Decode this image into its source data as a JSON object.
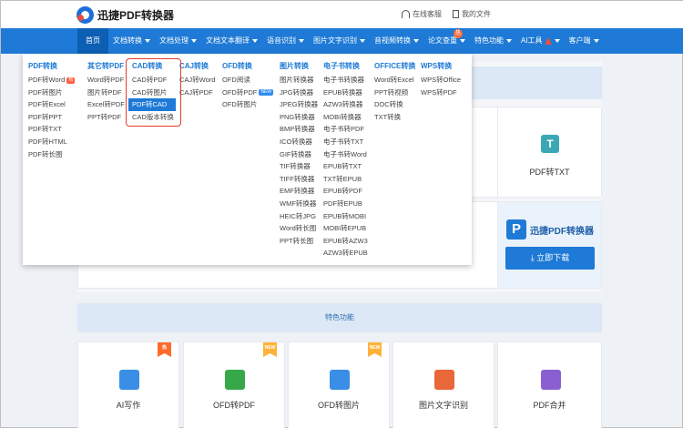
{
  "header": {
    "logo_text": "迅捷PDF转换器",
    "links": [
      {
        "label": "在线客服",
        "icon": "headset-icon"
      },
      {
        "label": "我的文件",
        "icon": "file-icon"
      }
    ]
  },
  "nav": {
    "items": [
      {
        "label": "首页",
        "active": true
      },
      {
        "label": "文档转换",
        "caret": true
      },
      {
        "label": "文档处理",
        "caret": true
      },
      {
        "label": "文档文本翻译",
        "caret": true
      },
      {
        "label": "语音识别",
        "caret": true
      },
      {
        "label": "图片文字识别",
        "caret": true
      },
      {
        "label": "音视频转换",
        "caret": true
      },
      {
        "label": "论文查重",
        "caret": true,
        "badge": "热"
      },
      {
        "label": "特色功能",
        "caret": true
      },
      {
        "label": "AI工具",
        "caret": true,
        "flame": true
      },
      {
        "label": "客户端",
        "caret": true
      }
    ]
  },
  "dropdown": {
    "columns": [
      {
        "title": "PDF转换",
        "items": [
          {
            "label": "PDF转Word",
            "tag": "hot"
          },
          {
            "label": "PDF转图片"
          },
          {
            "label": "PDF转Excel"
          },
          {
            "label": "PDF转PPT"
          },
          {
            "label": "PDF转TXT"
          },
          {
            "label": "PDF转HTML"
          },
          {
            "label": "PDF转长图"
          }
        ]
      },
      {
        "title": "其它转PDF",
        "items": [
          {
            "label": "Word转PDF"
          },
          {
            "label": "图片转PDF"
          },
          {
            "label": "Excel转PDF"
          },
          {
            "label": "PPT转PDF"
          }
        ]
      },
      {
        "title": "CAD转换",
        "items": [
          {
            "label": "CAD转PDF"
          },
          {
            "label": "CAD转图片"
          },
          {
            "label": "PDF转CAD",
            "selected": true
          },
          {
            "label": "CAD版本转换"
          }
        ]
      },
      {
        "title": "CAJ转换",
        "items": [
          {
            "label": "CAJ转Word"
          },
          {
            "label": "CAJ转PDF"
          }
        ]
      },
      {
        "title": "OFD转换",
        "items": [
          {
            "label": "OFD阅读"
          },
          {
            "label": "OFD转PDF",
            "tag": "new"
          },
          {
            "label": "OFD转图片"
          }
        ]
      },
      {
        "title": "图片转换",
        "items": [
          {
            "label": "图片转换器"
          },
          {
            "label": "JPG转换器"
          },
          {
            "label": "JPEG转换器"
          },
          {
            "label": "PNG转换器"
          },
          {
            "label": "BMP转换器"
          },
          {
            "label": "ICO转换器"
          },
          {
            "label": "GIF转换器"
          },
          {
            "label": "TIF转换器"
          },
          {
            "label": "TIFF转换器"
          },
          {
            "label": "EMF转换器"
          },
          {
            "label": "WMF转换器"
          },
          {
            "label": "HEIC转JPG"
          },
          {
            "label": "Word转长图"
          },
          {
            "label": "PPT转长图"
          }
        ]
      },
      {
        "title": "电子书转换",
        "items": [
          {
            "label": "电子书转换器"
          },
          {
            "label": "EPUB转换器"
          },
          {
            "label": "AZW3转换器"
          },
          {
            "label": "MOBI转换器"
          },
          {
            "label": "电子书转PDF"
          },
          {
            "label": "电子书转TXT"
          },
          {
            "label": "电子书转Word"
          },
          {
            "label": "EPUB转TXT"
          },
          {
            "label": "TXT转EPUB"
          },
          {
            "label": "EPUB转PDF"
          },
          {
            "label": "PDF转EPUB"
          },
          {
            "label": "EPUB转MOBI"
          },
          {
            "label": "MOBI转EPUB"
          },
          {
            "label": "EPUB转AZW3"
          },
          {
            "label": "AZW3转EPUB"
          }
        ]
      },
      {
        "title": "OFFICE转换",
        "items": [
          {
            "label": "Word转Excel"
          },
          {
            "label": "PPT转视频"
          },
          {
            "label": "DOC转换"
          },
          {
            "label": "TXT转换"
          }
        ]
      },
      {
        "title": "WPS转换",
        "items": [
          {
            "label": "WPS转Office"
          },
          {
            "label": "WPS转PDF"
          }
        ]
      }
    ],
    "tags": {
      "hot": "热",
      "new": "NEW"
    }
  },
  "background": {
    "pdf_txt_label": "PDF转TXT",
    "pdf_txt_icon_letter": "T",
    "promo_logo_text": "迅捷PDF转换器",
    "promo_logo_letter": "P",
    "download_label": "立即下载",
    "feature_section_title": "特色功能",
    "features": [
      {
        "label": "AI写作",
        "icon": "pen-icon",
        "color": "#3a8ee6",
        "corner": "hot"
      },
      {
        "label": "OFD转PDF",
        "icon": "pdf-icon",
        "color": "#37a84a",
        "corner": "new"
      },
      {
        "label": "OFD转图片",
        "icon": "image-icon",
        "color": "#3a8ee6",
        "corner": "new"
      },
      {
        "label": "图片文字识别",
        "icon": "scan-icon",
        "color": "#e8683a"
      },
      {
        "label": "PDF合并",
        "icon": "merge-icon",
        "color": "#8a5fd1"
      }
    ],
    "corner_labels": {
      "hot": "热",
      "new": "NEW"
    }
  },
  "colors": {
    "brand": "#1e7ad6",
    "highlight": "#e23b2e"
  }
}
